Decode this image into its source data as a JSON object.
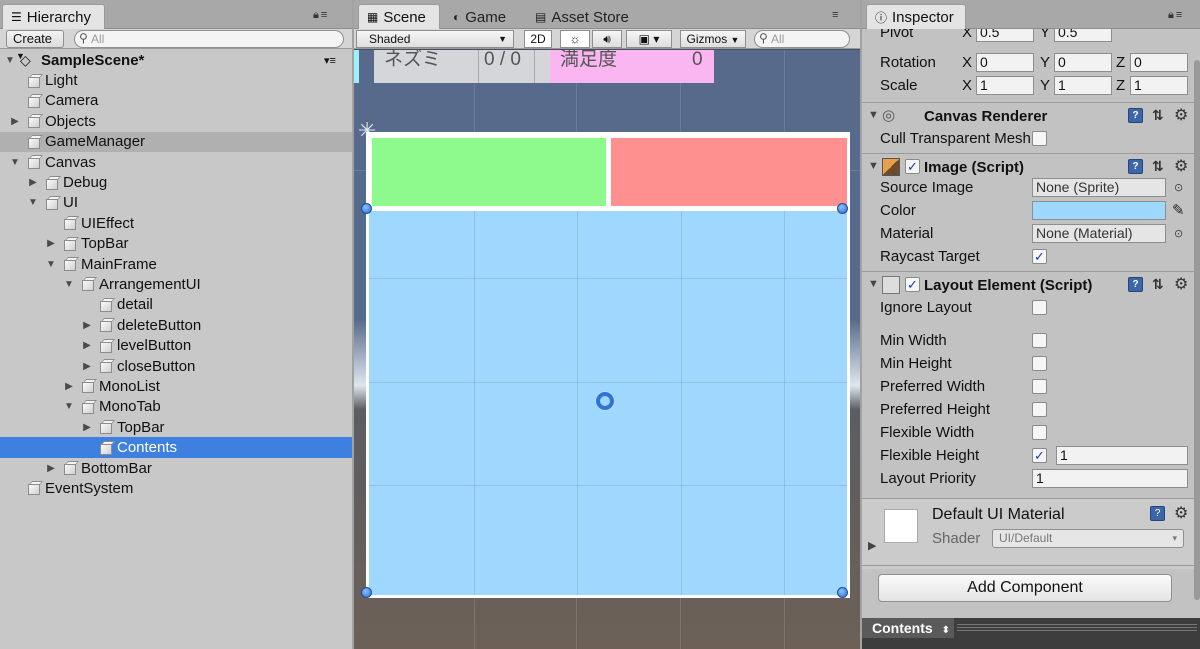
{
  "hierarchy": {
    "tab_label": "Hierarchy",
    "create_label": "Create",
    "search_placeholder": "All",
    "scene_name": "SampleScene*",
    "items": [
      {
        "label": "Light",
        "depth": 1,
        "arrow": ""
      },
      {
        "label": "Camera",
        "depth": 1,
        "arrow": ""
      },
      {
        "label": "Objects",
        "depth": 1,
        "arrow": "▶"
      },
      {
        "label": "GameManager",
        "depth": 1,
        "arrow": ""
      },
      {
        "label": "Canvas",
        "depth": 1,
        "arrow": "▼"
      },
      {
        "label": "Debug",
        "depth": 2,
        "arrow": "▶"
      },
      {
        "label": "UI",
        "depth": 2,
        "arrow": "▼"
      },
      {
        "label": "UIEffect",
        "depth": 3,
        "arrow": ""
      },
      {
        "label": "TopBar",
        "depth": 3,
        "arrow": "▶"
      },
      {
        "label": "MainFrame",
        "depth": 3,
        "arrow": "▼"
      },
      {
        "label": "ArrangementUI",
        "depth": 4,
        "arrow": "▼"
      },
      {
        "label": "detail",
        "depth": 5,
        "arrow": ""
      },
      {
        "label": "deleteButton",
        "depth": 5,
        "arrow": "▶"
      },
      {
        "label": "levelButton",
        "depth": 5,
        "arrow": "▶"
      },
      {
        "label": "closeButton",
        "depth": 5,
        "arrow": "▶"
      },
      {
        "label": "MonoList",
        "depth": 4,
        "arrow": "▶"
      },
      {
        "label": "MonoTab",
        "depth": 4,
        "arrow": "▼"
      },
      {
        "label": "TopBar",
        "depth": 5,
        "arrow": "▶"
      },
      {
        "label": "Contents",
        "depth": 5,
        "arrow": ""
      },
      {
        "label": "BottomBar",
        "depth": 3,
        "arrow": "▶"
      },
      {
        "label": "EventSystem",
        "depth": 1,
        "arrow": ""
      }
    ],
    "selected_index": 18,
    "highlight_index": 3
  },
  "scene": {
    "tabs": {
      "scene": "Scene",
      "game": "Game",
      "asset_store": "Asset Store"
    },
    "shading_mode": "Shaded",
    "mode_2d": "2D",
    "gizmos_label": "Gizmos",
    "search_placeholder": "All",
    "preview": {
      "name": "ネズミ",
      "count": "0 /  0",
      "satisfaction_label": "満足度",
      "satisfaction_value": "0"
    }
  },
  "inspector": {
    "tab_label": "Inspector",
    "pivot": {
      "label": "Pivot",
      "x": "0.5",
      "y": "0.5"
    },
    "rotation": {
      "label": "Rotation",
      "x": "0",
      "y": "0",
      "z": "0"
    },
    "scale": {
      "label": "Scale",
      "x": "1",
      "y": "1",
      "z": "1"
    },
    "axis": {
      "x": "X",
      "y": "Y",
      "z": "Z"
    },
    "canvas_renderer": {
      "title": "Canvas Renderer",
      "cull_label": "Cull Transparent Mesh"
    },
    "image": {
      "title": "Image (Script)",
      "source_image_label": "Source Image",
      "source_image_value": "None (Sprite)",
      "color_label": "Color",
      "color_value": "#9ed8ff",
      "material_label": "Material",
      "material_value": "None (Material)",
      "raycast_label": "Raycast Target"
    },
    "layout_element": {
      "title": "Layout Element (Script)",
      "ignore_layout": "Ignore Layout",
      "min_width": "Min Width",
      "min_height": "Min Height",
      "preferred_width": "Preferred Width",
      "preferred_height": "Preferred Height",
      "flexible_width": "Flexible Width",
      "flexible_height": "Flexible Height",
      "flexible_height_value": "1",
      "layout_priority": "Layout Priority",
      "layout_priority_value": "1"
    },
    "material": {
      "name": "Default UI Material",
      "shader_label": "Shader",
      "shader_value": "UI/Default"
    },
    "add_component": "Add Component",
    "footer_label": "Contents"
  }
}
